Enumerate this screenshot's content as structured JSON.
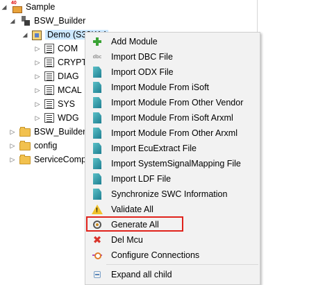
{
  "tree": {
    "nodes": [
      {
        "label": "Sample",
        "expander": "◢",
        "icon": "project-icon"
      },
      {
        "label": "BSW_Builder",
        "expander": "◢",
        "icon": "bsw-builder-icon"
      },
      {
        "label": "Demo (S32K14",
        "expander": "◢",
        "icon": "mcu-chip-icon"
      },
      {
        "label": "COM",
        "expander": "▷",
        "icon": "module-list-icon"
      },
      {
        "label": "CRYPT",
        "expander": "▷",
        "icon": "module-list-icon"
      },
      {
        "label": "DIAG",
        "expander": "▷",
        "icon": "module-list-icon"
      },
      {
        "label": "MCAL",
        "expander": "▷",
        "icon": "module-list-icon"
      },
      {
        "label": "SYS",
        "expander": "▷",
        "icon": "module-list-icon"
      },
      {
        "label": "WDG",
        "expander": "▷",
        "icon": "module-list-icon"
      },
      {
        "label": "BSW_Builder",
        "expander": "▷",
        "icon": "folder-icon"
      },
      {
        "label": "config",
        "expander": "▷",
        "icon": "folder-icon"
      },
      {
        "label": "ServiceComp",
        "expander": "▷",
        "icon": "folder-icon"
      }
    ]
  },
  "context_menu": {
    "items": [
      {
        "label": "Add Module",
        "icon": "add-icon"
      },
      {
        "label": "Import DBC File",
        "icon": "dbc-icon"
      },
      {
        "label": "Import ODX File",
        "icon": "import-icon"
      },
      {
        "label": "Import Module From iSoft",
        "icon": "import-icon"
      },
      {
        "label": "Import Module From Other Vendor",
        "icon": "import-icon"
      },
      {
        "label": "Import Module From iSoft Arxml",
        "icon": "import-icon"
      },
      {
        "label": "Import Module From Other Arxml",
        "icon": "import-icon"
      },
      {
        "label": "Import EcuExtract File",
        "icon": "import-icon"
      },
      {
        "label": "Import SystemSignalMapping File",
        "icon": "import-icon"
      },
      {
        "label": "Import LDF File",
        "icon": "import-icon"
      },
      {
        "label": "Synchronize SWC Information",
        "icon": "import-icon"
      },
      {
        "label": "Validate All",
        "icon": "warning-icon"
      },
      {
        "label": "Generate All",
        "icon": "generate-gear-icon",
        "highlighted": true
      },
      {
        "label": "Del Mcu",
        "icon": "delete-icon"
      },
      {
        "label": "Configure Connections",
        "icon": "connections-icon"
      },
      {
        "label": "Expand all child",
        "icon": "expand-icon"
      }
    ]
  },
  "glyphs": {
    "dbc": "dbc",
    "warn": "!",
    "x": "✖"
  },
  "colors": {
    "highlight_border": "#e0221b",
    "selection": "#cce8ff",
    "menu_bg": "#f2f2f2"
  }
}
